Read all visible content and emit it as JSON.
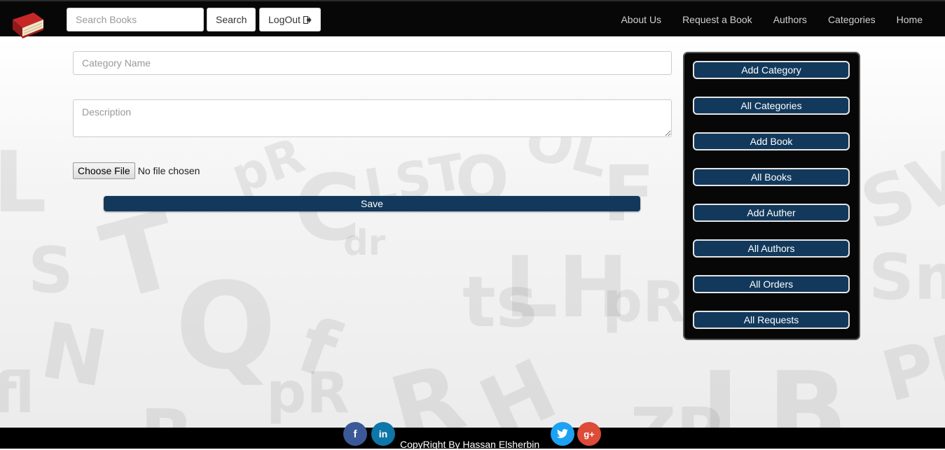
{
  "navbar": {
    "search_placeholder": "Search Books",
    "search_label": "Search",
    "logout_label": "LogOut",
    "links": [
      "About Us",
      "Request a Book",
      "Authors",
      "Categories",
      "Home"
    ]
  },
  "form": {
    "category_placeholder": "Category Name",
    "description_placeholder": "Description",
    "file_button_label": "Choose File",
    "file_status": "No file chosen",
    "save_label": "Save"
  },
  "admin_panel": {
    "items": [
      "Add Category",
      "All Categories",
      "Add Book",
      "All Books",
      "Add Auther",
      "All Authors",
      "All Orders",
      "All Requests"
    ]
  },
  "footer": {
    "copyright": "CopyRight By Hassan Elsherbin",
    "social_icons": [
      "facebook-icon",
      "linkedin-icon",
      "twitter-icon",
      "google-plus-icon"
    ]
  },
  "colors": {
    "navbar_bg": "#070707",
    "button_blue": "#12395c",
    "facebook": "#3b5998",
    "linkedin": "#0e76a8",
    "twitter": "#1da1f2",
    "google_plus": "#dd4b39"
  }
}
